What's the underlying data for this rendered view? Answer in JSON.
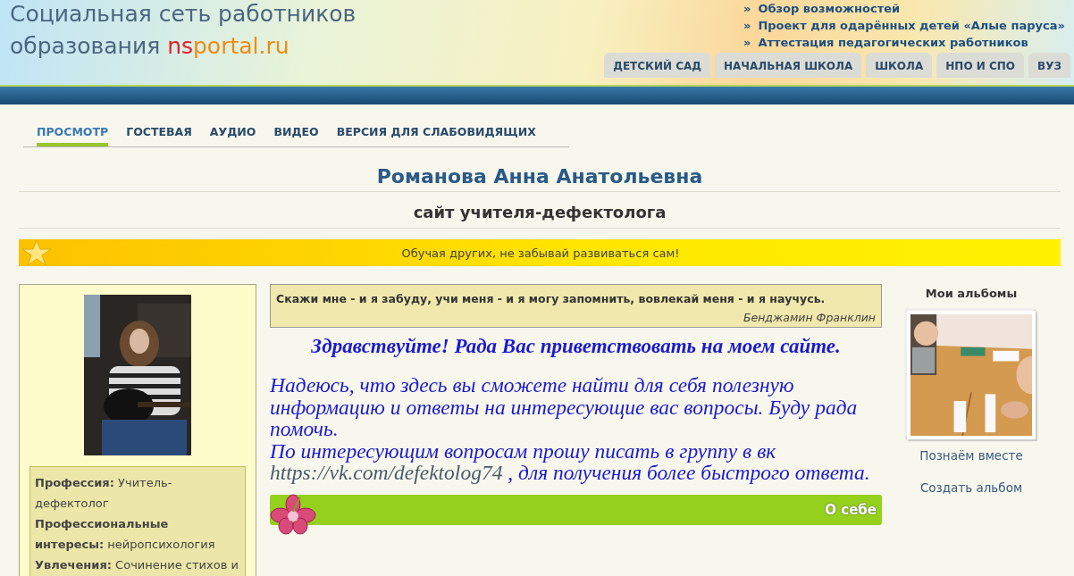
{
  "header": {
    "title_line1": "Социальная сеть работников",
    "title_line2_prefix": "образования ",
    "logo_ns": "ns",
    "logo_rest": "portal.ru",
    "links": [
      {
        "bullet": "»",
        "label": "Обзор возможностей"
      },
      {
        "bullet": "»",
        "label": "Проект для одарённых детей «Алые паруса»"
      },
      {
        "bullet": "»",
        "label": "Аттестация педагогических работников"
      }
    ],
    "tabs": [
      "ДЕТСКИЙ САД",
      "НАЧАЛЬНАЯ ШКОЛА",
      "ШКОЛА",
      "НПО И СПО",
      "ВУЗ"
    ]
  },
  "nav": [
    {
      "label": "ПРОСМОТР",
      "selected": true
    },
    {
      "label": "ГОСТЕВАЯ",
      "selected": false
    },
    {
      "label": "АУДИО",
      "selected": false
    },
    {
      "label": "ВИДЕО",
      "selected": false
    },
    {
      "label": "ВЕРСИЯ ДЛЯ СЛАБОВИДЯЩИХ",
      "selected": false
    }
  ],
  "owner_name": "Романова Анна Анатольевна",
  "site_title": "сайт учителя-дефектолога",
  "motto": "Обучая других, не забывай развиваться сам!",
  "profile": {
    "facts": [
      "**Профессия:** Учитель-дефектолог",
      "**Профессиональные интересы:** нейропсихология",
      "**Увлечения:** Сочинение стихов и"
    ]
  },
  "quote": {
    "text": "Скажи мне - и я забуду, учи меня - и я могу запомнить, вовлекай меня - и я научусь.",
    "author": "Бенджамин Франклин"
  },
  "greeting": "Здравствуйте! Рада Вас приветствовать на моем сайте.",
  "intro": "Надеюсь, что здесь вы сможете найти для себя полезную информацию и ответы на интересующие вас вопросы. Буду рада помочь.",
  "contact_prefix": "По интересующим вопросам прошу писать в группу  в вк ",
  "contact_link": "https://vk.com/defektolog74",
  "contact_suffix": " , для получения более быстрого ответа.",
  "section_bar": "О себе",
  "albums": {
    "title": "Мои альбомы",
    "album_name": "Познаём вместе",
    "create": "Создать альбом"
  }
}
